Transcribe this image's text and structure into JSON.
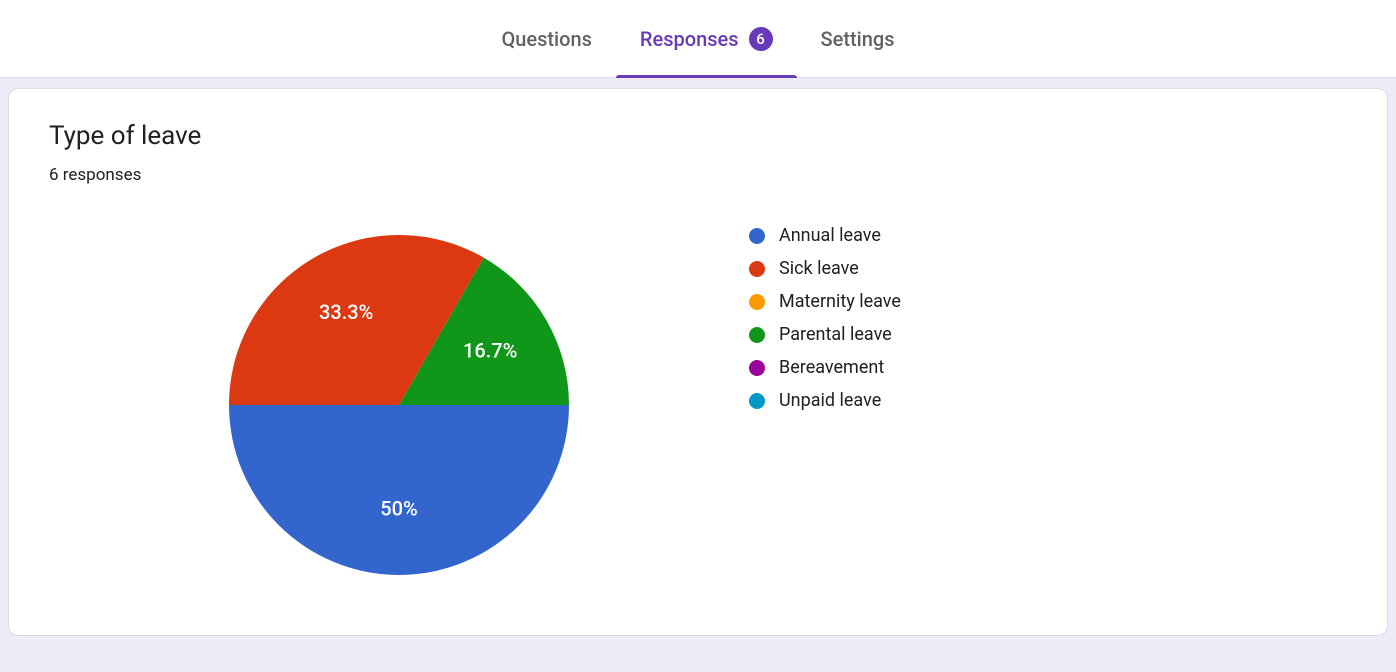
{
  "tabs": {
    "questions": "Questions",
    "responses": "Responses",
    "settings": "Settings",
    "responses_count": "6"
  },
  "card": {
    "title": "Type of leave",
    "subtitle": "6 responses"
  },
  "chart_data": {
    "type": "pie",
    "series": [
      {
        "name": "Annual leave",
        "value": 3,
        "percent": 50.0,
        "label": "50%",
        "color": "#3366cc"
      },
      {
        "name": "Sick leave",
        "value": 2,
        "percent": 33.3,
        "label": "33.3%",
        "color": "#dc3912"
      },
      {
        "name": "Maternity leave",
        "value": 0,
        "percent": 0,
        "label": "",
        "color": "#ff9900"
      },
      {
        "name": "Parental leave",
        "value": 1,
        "percent": 16.7,
        "label": "16.7%",
        "color": "#109618"
      },
      {
        "name": "Bereavement",
        "value": 0,
        "percent": 0,
        "label": "",
        "color": "#990099"
      },
      {
        "name": "Unpaid leave",
        "value": 0,
        "percent": 0,
        "label": "",
        "color": "#0099c6"
      }
    ]
  }
}
